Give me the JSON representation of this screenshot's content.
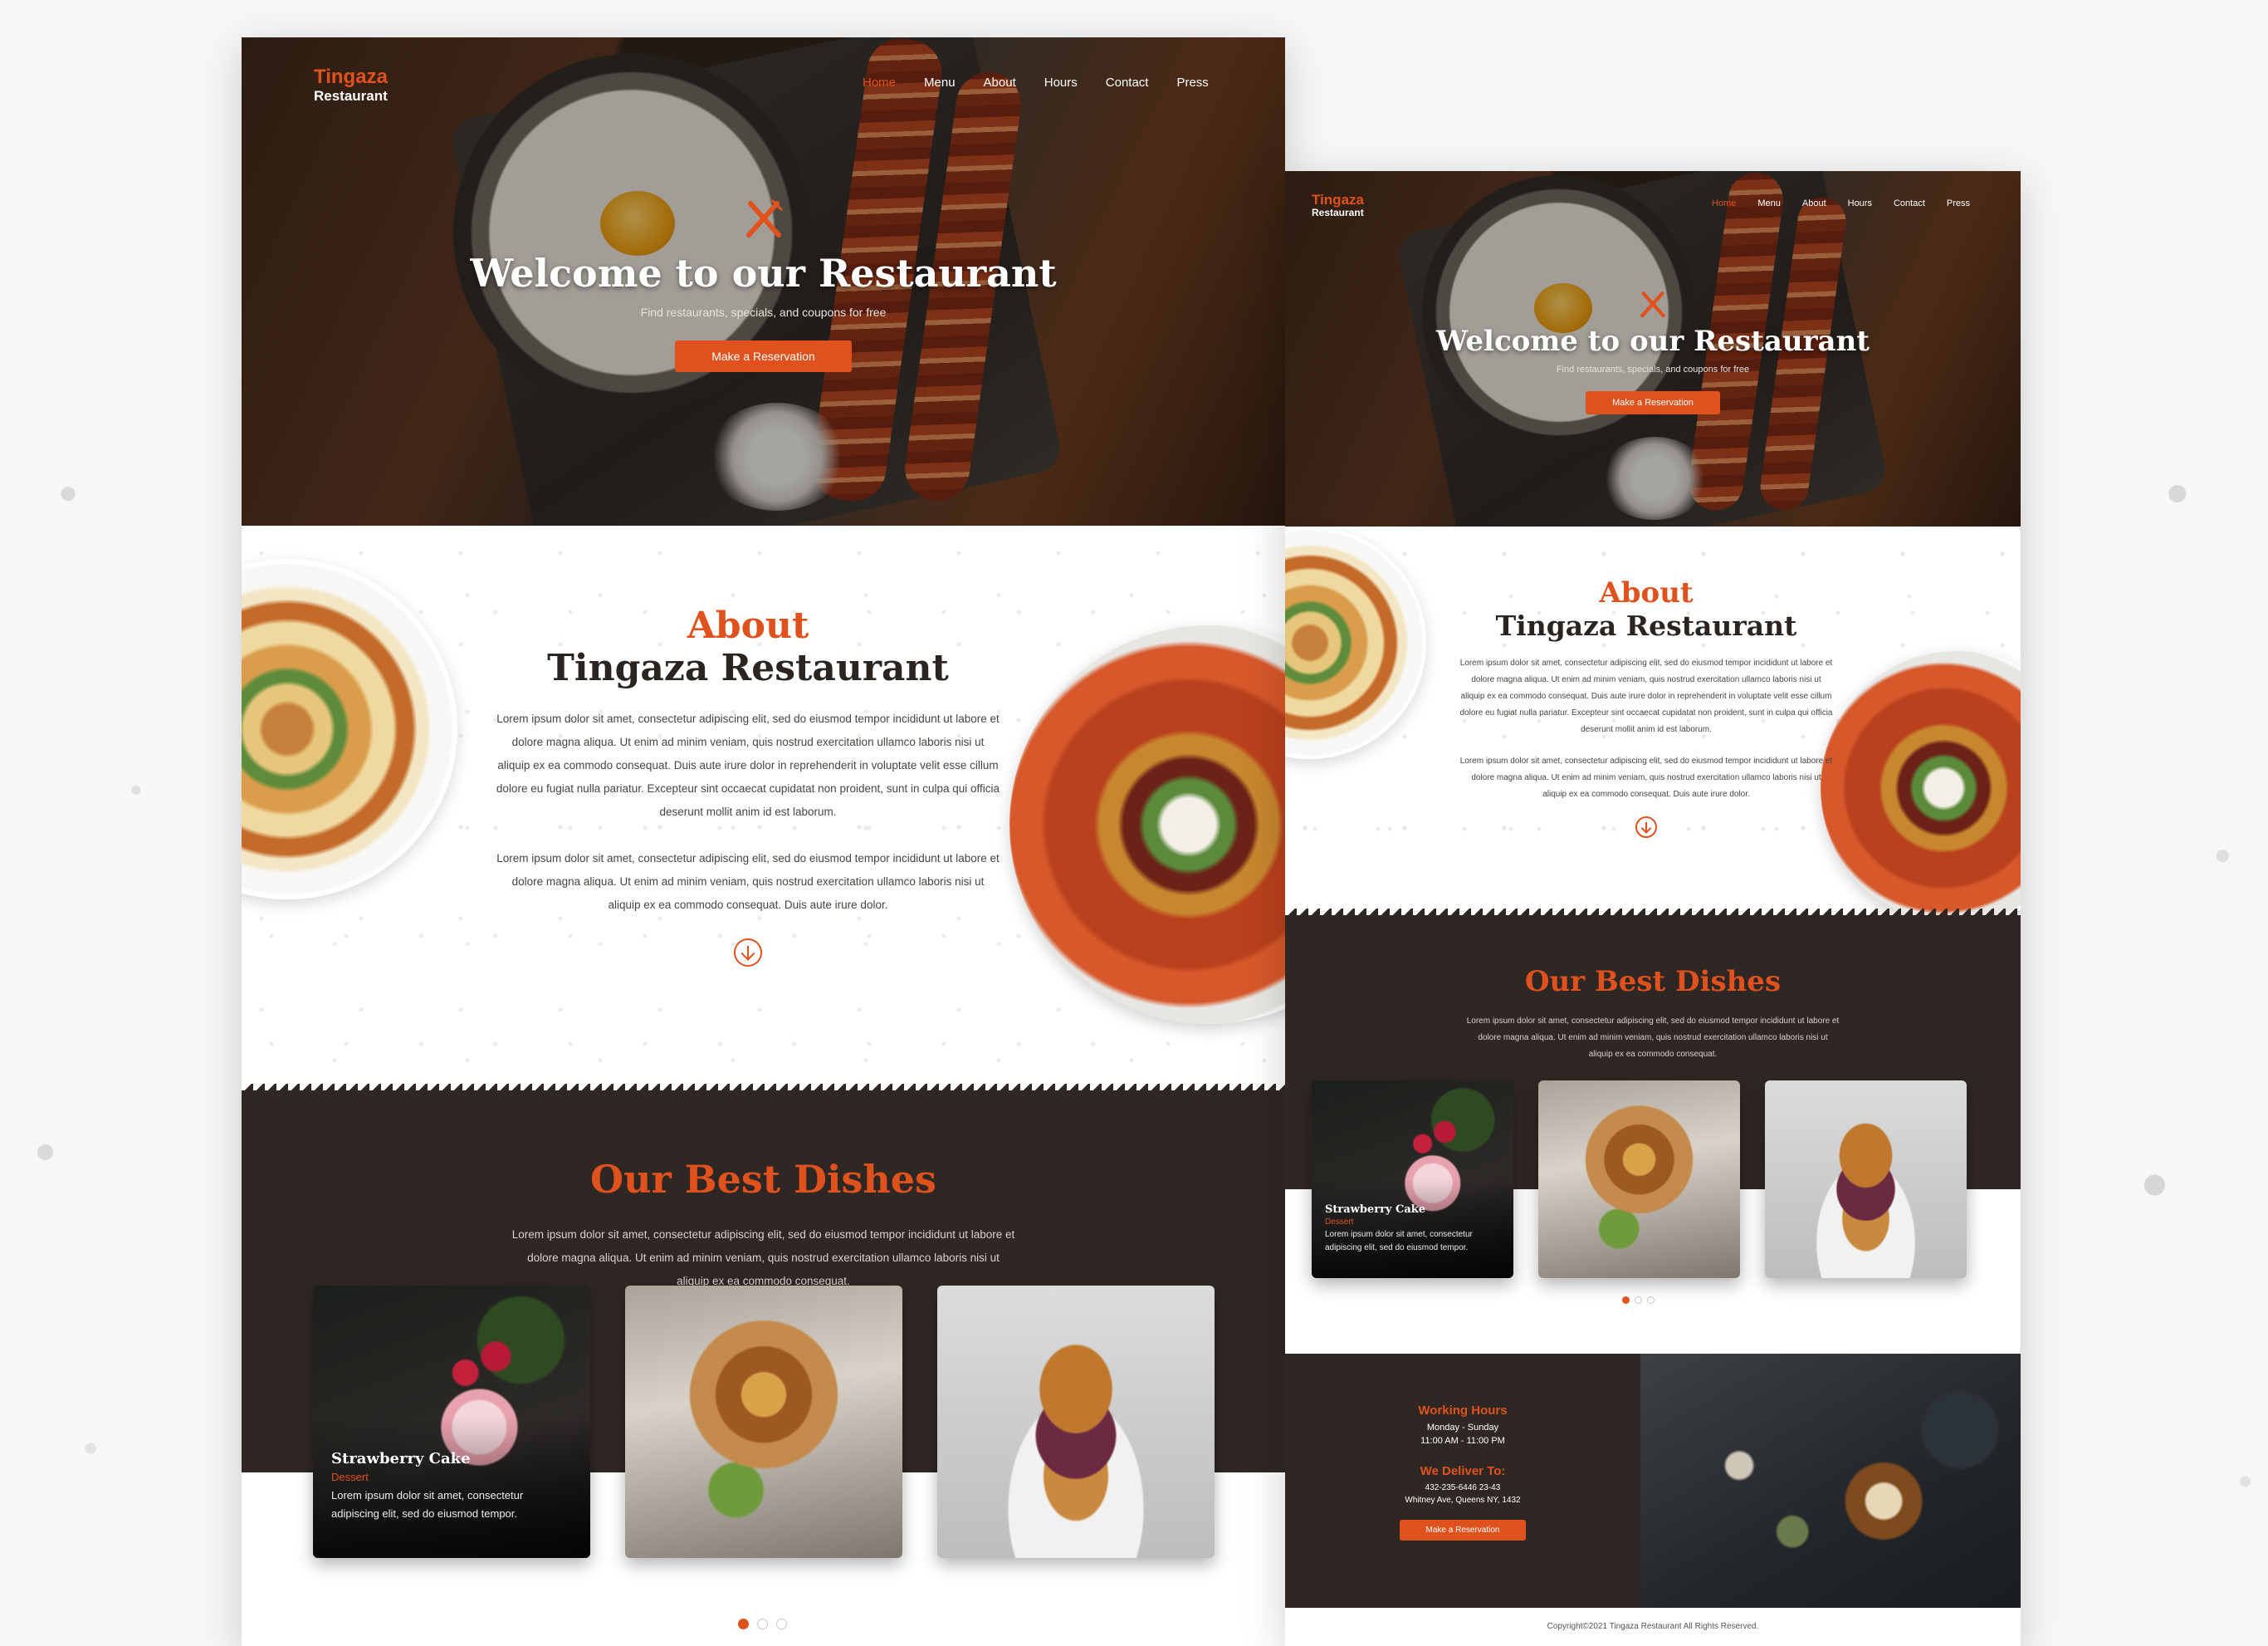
{
  "brand": {
    "name": "Tingaza",
    "sub": "Restaurant"
  },
  "nav": [
    "Home",
    "Menu",
    "About",
    "Hours",
    "Contact",
    "Press"
  ],
  "hero": {
    "title": "Welcome to our Restaurant",
    "subtitle": "Find restaurants, specials, and coupons for free",
    "button": "Make a Reservation"
  },
  "about": {
    "heading": "About",
    "name": "Tingaza Restaurant",
    "para1": "Lorem ipsum dolor sit amet, consectetur adipiscing elit, sed do eiusmod tempor incididunt ut labore et dolore magna aliqua. Ut enim ad minim veniam, quis nostrud exercitation ullamco laboris nisi ut aliquip ex ea commodo consequat. Duis aute irure dolor in reprehenderit in voluptate velit esse cillum dolore eu fugiat nulla pariatur. Excepteur sint occaecat cupidatat non proident, sunt in culpa qui officia deserunt mollit anim id est laborum.",
    "para2": "Lorem ipsum dolor sit amet, consectetur adipiscing elit, sed do eiusmod tempor incididunt ut labore et dolore magna aliqua. Ut enim ad minim veniam, quis nostrud exercitation ullamco laboris nisi ut aliquip ex ea commodo consequat. Duis aute irure dolor."
  },
  "dishes": {
    "heading": "Our Best Dishes",
    "text": "Lorem ipsum dolor sit amet, consectetur adipiscing elit, sed do eiusmod tempor incididunt ut labore et dolore magna aliqua. Ut enim ad minim veniam, quis nostrud exercitation ullamco laboris nisi ut aliquip ex ea commodo consequat.",
    "card": {
      "title": "Strawberry Cake",
      "tag": "Dessert",
      "desc": "Lorem ipsum dolor sit amet, consectetur adipiscing elit, sed do eiusmod tempor."
    }
  },
  "info": {
    "hours_title": "Working Hours",
    "days": "Monday - Sunday",
    "time": "11:00 AM - 11:00 PM",
    "deliver_title": "We Deliver To:",
    "phone": "432-235-6446 23-43",
    "address": "Whitney Ave, Queens NY, 1432",
    "button": "Make a Reservation"
  },
  "footer": "Copyright©2021 Tingaza Restaurant All Rights Reserved.",
  "colors": {
    "accent": "#e0521d",
    "dark": "#2f2724"
  }
}
